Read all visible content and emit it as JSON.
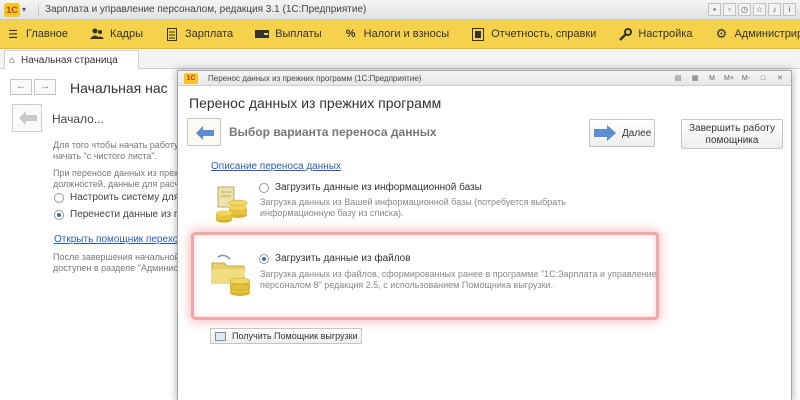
{
  "window": {
    "title": "Зарплата и управление персоналом, редакция 3.1 (1С:Предприятие)",
    "logo_text": "1С"
  },
  "menu": {
    "items": [
      {
        "label": "Главное",
        "icon": "hamburger-icon"
      },
      {
        "label": "Кадры",
        "icon": "people-icon"
      },
      {
        "label": "Зарплата",
        "icon": "document-icon"
      },
      {
        "label": "Выплаты",
        "icon": "wallet-icon"
      },
      {
        "label": "Налоги и взносы",
        "icon": "percent-icon"
      },
      {
        "label": "Отчетность, справки",
        "icon": "report-icon"
      },
      {
        "label": "Настройка",
        "icon": "wrench-icon"
      },
      {
        "label": "Администрирование",
        "icon": "gear-icon"
      }
    ]
  },
  "tabs": {
    "home": "Начальная страница"
  },
  "background": {
    "title": "Начальная нас",
    "subtitle": "Начало...",
    "text1_line1": "Для того чтобы начать работу с",
    "text1_line2": "начать \"с чистого листа\".",
    "text2_line1": "При переносе данных из преж",
    "text2_line2": "должностей, данные для расче",
    "radio1": "Настроить систему для раб",
    "radio2": "Перенести данные из преж",
    "link": "Открыть помощник перехода с",
    "text3_line1": "После завершения начальной",
    "text3_line2": "доступен в разделе \"Админист"
  },
  "dialog": {
    "window_title": "Перенос данных из прежних программ  (1С:Предприятие)",
    "logo_text": "1С",
    "title": "Перенос данных из прежних программ",
    "section_title": "Выбор варианта переноса данных",
    "next_label": "Далее",
    "finish_line1": "Завершить работу",
    "finish_line2": "помощника",
    "description_link": "Описание переноса данных",
    "option1": {
      "label": "Загрузить данные из информационной базы",
      "desc_line1": "Загрузка данных из Вашей информационной базы (потребуется выбрать",
      "desc_line2": "информационную базу из списка)."
    },
    "option2": {
      "label": "Загрузить данные из файлов",
      "desc_line1": "Загрузка данных из файлов, сформированных ранее в программе \"1С:Зарплата и управление",
      "desc_line2": "персоналом 8\" редакция 2.5, с использованием Помощника выгрузки."
    },
    "get_helper_label": "Получить Помощник выгрузки",
    "tools": [
      "M",
      "M+",
      "M-"
    ]
  },
  "colors": {
    "menubar": "#f6d24a",
    "link": "#2a5db0",
    "highlight": "#f0a8a8"
  }
}
